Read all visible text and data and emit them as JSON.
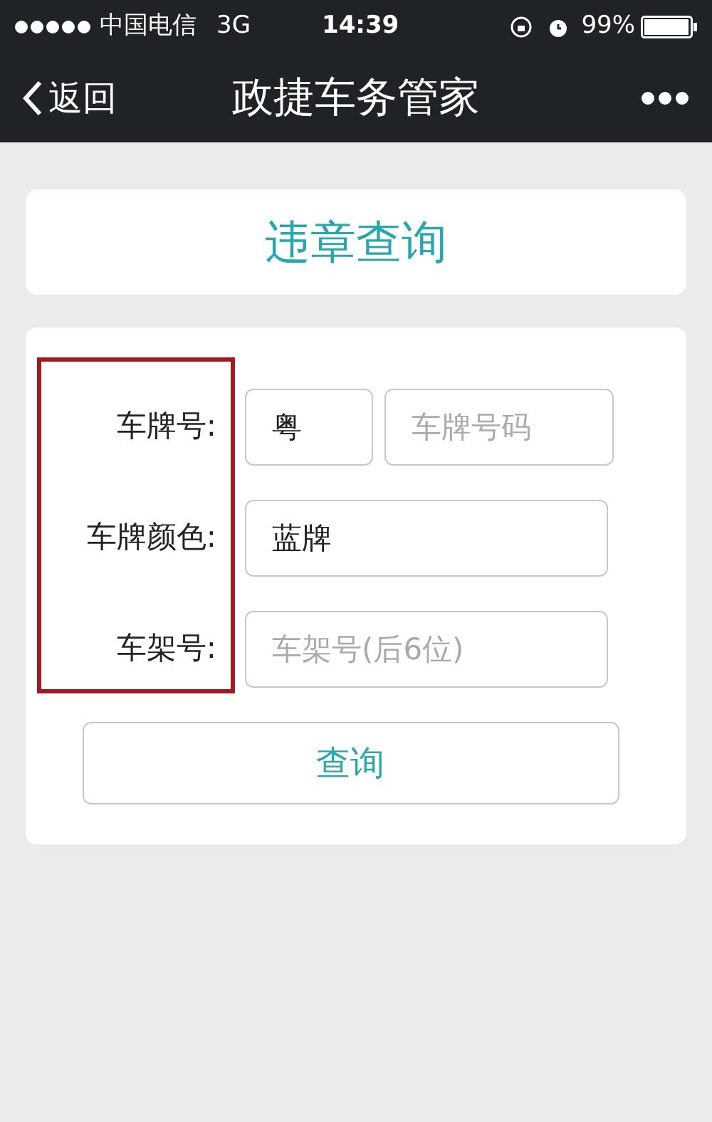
{
  "status_bar": {
    "carrier": "中国电信",
    "network": "3G",
    "time": "14:39",
    "battery": "99%"
  },
  "nav": {
    "back": "返回",
    "title": "政捷车务管家"
  },
  "header": {
    "title": "违章查询"
  },
  "form": {
    "rows": [
      {
        "kind": "plate",
        "label": "车牌号:",
        "province": "粤",
        "placeholder": "车牌号码"
      },
      {
        "kind": "value",
        "label": "车牌颜色:",
        "value": "蓝牌"
      },
      {
        "kind": "placeholder",
        "label": "车架号:",
        "placeholder": "车架号(后6位)"
      }
    ],
    "button": "查询"
  }
}
